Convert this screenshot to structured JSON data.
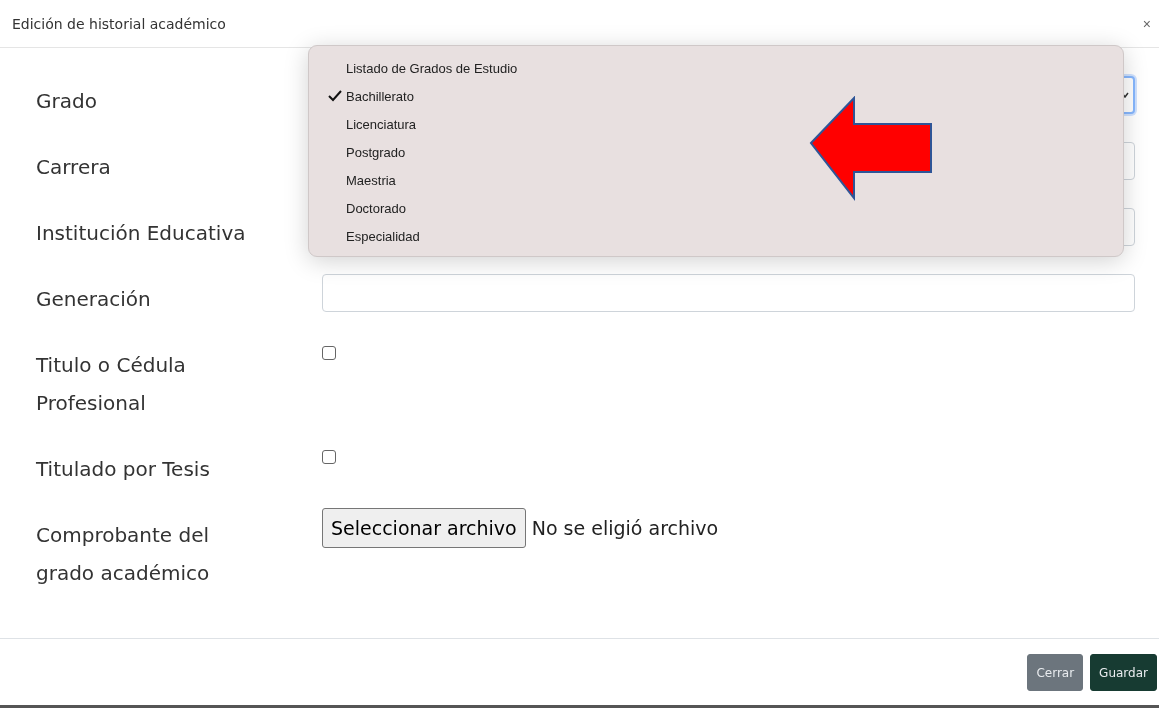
{
  "dialog": {
    "title": "Edición de historial académico",
    "close": "×"
  },
  "fields": [
    {
      "label": "Grado",
      "kind": "select",
      "focused": true
    },
    {
      "label": "Carrera",
      "kind": "text"
    },
    {
      "label": "Institución Educativa",
      "kind": "text"
    },
    {
      "label": "Generación",
      "kind": "text"
    },
    {
      "label": "Titulo o Cédula Profesional",
      "kind": "checkbox",
      "checked": false
    },
    {
      "label": "Titulado por Tesis",
      "kind": "checkbox",
      "checked": false
    },
    {
      "label": "Comprobante del grado académico",
      "kind": "file",
      "button": "Seleccionar archivo",
      "status": "No se eligió archivo"
    }
  ],
  "dropdown": {
    "options": [
      {
        "label": "Listado de Grados de Estudio",
        "selected": false
      },
      {
        "label": "Bachillerato",
        "selected": true
      },
      {
        "label": "Licenciatura",
        "selected": false
      },
      {
        "label": "Postgrado",
        "selected": false
      },
      {
        "label": "Maestria",
        "selected": false
      },
      {
        "label": "Doctorado",
        "selected": false
      },
      {
        "label": "Especialidad",
        "selected": false
      }
    ]
  },
  "buttons": [
    {
      "label": "Cerrar",
      "kind": "secondary"
    },
    {
      "label": "Guardar",
      "kind": "primary"
    }
  ]
}
